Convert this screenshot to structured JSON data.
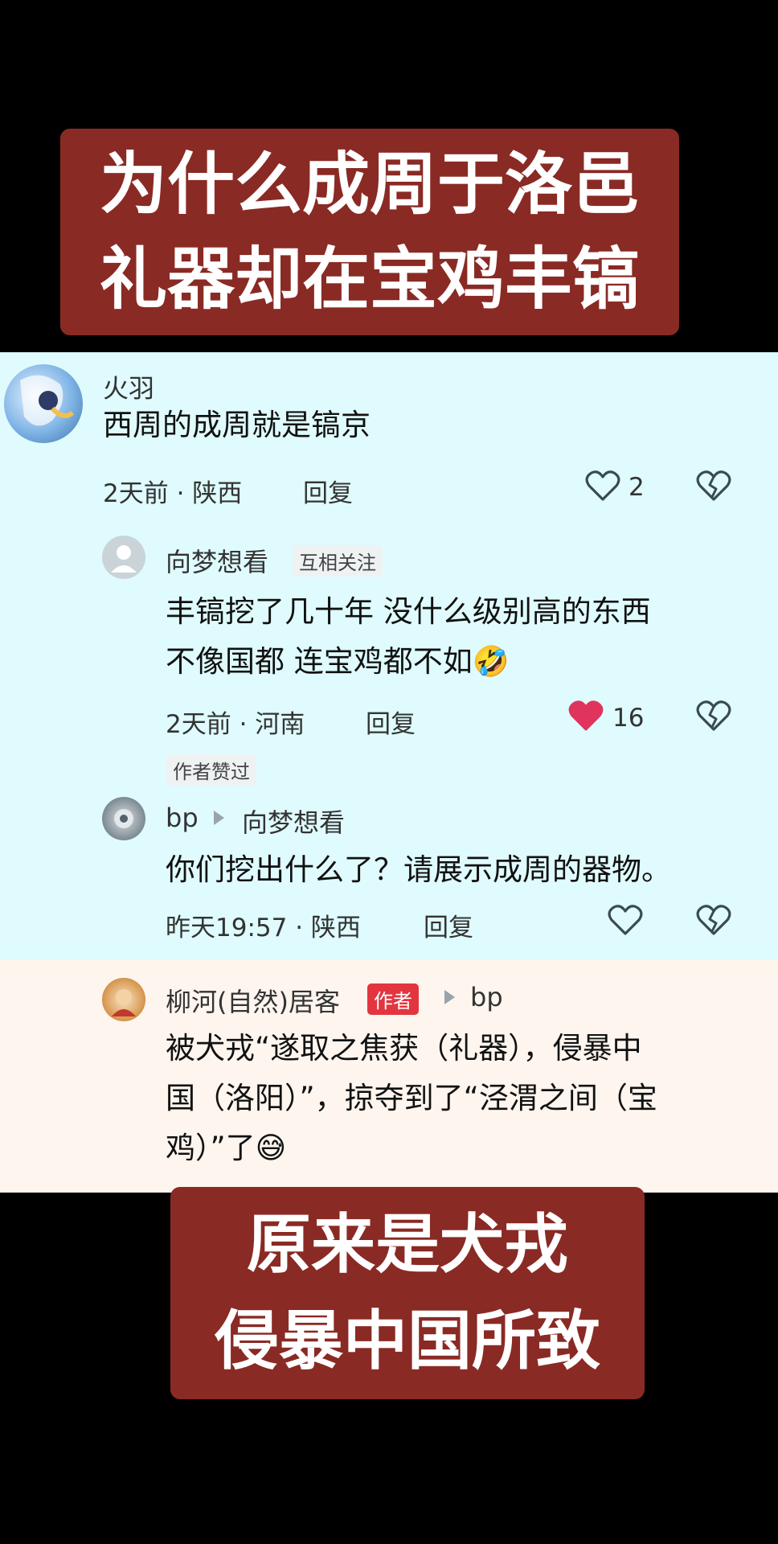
{
  "top_banner": {
    "line1": "为什么成周于洛邑",
    "line2": "礼器却在宝鸡丰镐"
  },
  "bottom_banner": {
    "line1": "原来是犬戎",
    "line2": "侵暴中国所致"
  },
  "colors": {
    "banner": "#8a2a24",
    "panel_blue": "#dffbfd",
    "panel_cream": "#fdf5ee",
    "heart_liked": "#e0335d",
    "author_badge": "#e2353f"
  },
  "comments": [
    {
      "username": "火羽",
      "text": "西周的成周就是镐京",
      "time": "2天前",
      "location": "陕西",
      "reply_label": "回复",
      "like_count": "2",
      "liked": false
    },
    {
      "username": "向梦想看",
      "tag": "互相关注",
      "line1": "丰镐挖了几十年 没什么级别高的东西",
      "line2": "不像国都 连宝鸡都不如",
      "emoji": "🤣",
      "time": "2天前",
      "location": "河南",
      "reply_label": "回复",
      "like_count": "16",
      "liked": true,
      "author_liked": "作者赞过"
    },
    {
      "username": "bp",
      "reply_to": "向梦想看",
      "text": "你们挖出什么了？请展示成周的器物。",
      "time": "昨天19:57",
      "location": "陕西",
      "reply_label": "回复",
      "liked": false
    },
    {
      "username": "柳河(自然)居客",
      "badge": "作者",
      "reply_to": "bp",
      "line1": "被犬戎“遂取之焦获（礼器），侵暴中",
      "line2": "国（洛阳）”，掠夺到了“泾渭之间（宝",
      "line3": "鸡）”了",
      "emoji": "😅"
    }
  ],
  "icons": [
    "heart-outline-icon",
    "heart-filled-icon",
    "heart-broken-icon",
    "reply-arrow-icon",
    "default-avatar-icon"
  ]
}
